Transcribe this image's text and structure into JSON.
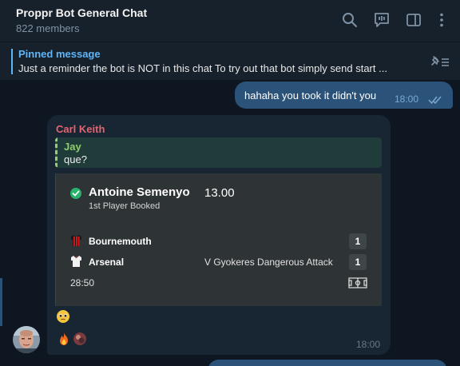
{
  "header": {
    "title": "Proppr Bot General Chat",
    "members": "822 members",
    "icons": [
      "search-icon",
      "live-stream-icon",
      "sidebar-icon",
      "more-vertical-icon"
    ]
  },
  "pinned": {
    "title": "Pinned message",
    "text": "Just a reminder the bot is NOT in this chat  To try out that bot simply send start ..."
  },
  "outgoing": {
    "text": "hahaha you took it didn't you",
    "time": "18:00",
    "status": "read"
  },
  "message": {
    "sender": "Carl Keith",
    "reply": {
      "name": "Jay",
      "text": "que?"
    },
    "bet": {
      "player": "Antoine Semenyo",
      "odds": "13.00",
      "market": "1st Player Booked",
      "teams": [
        {
          "name": "Bournemouth",
          "event": "",
          "score": "1",
          "shirt_colors": [
            "#d71920",
            "#1a1a1a"
          ]
        },
        {
          "name": "Arsenal",
          "event": "V Gyokeres Dangerous Attack",
          "score": "1",
          "shirt_colors": [
            "#ffffff",
            "#e03a3e"
          ]
        }
      ],
      "clock": "28:50"
    },
    "time": "18:00",
    "reactions": [
      "fire",
      "avatar"
    ]
  },
  "colors": {
    "background": "#0e1621",
    "header_bg": "#17212b",
    "outgoing_bubble": "#2b5278",
    "incoming_bubble": "#182533",
    "accent": "#5eb5f7",
    "sender_name": "#e5646f",
    "reply_name": "#8fcf6a"
  }
}
